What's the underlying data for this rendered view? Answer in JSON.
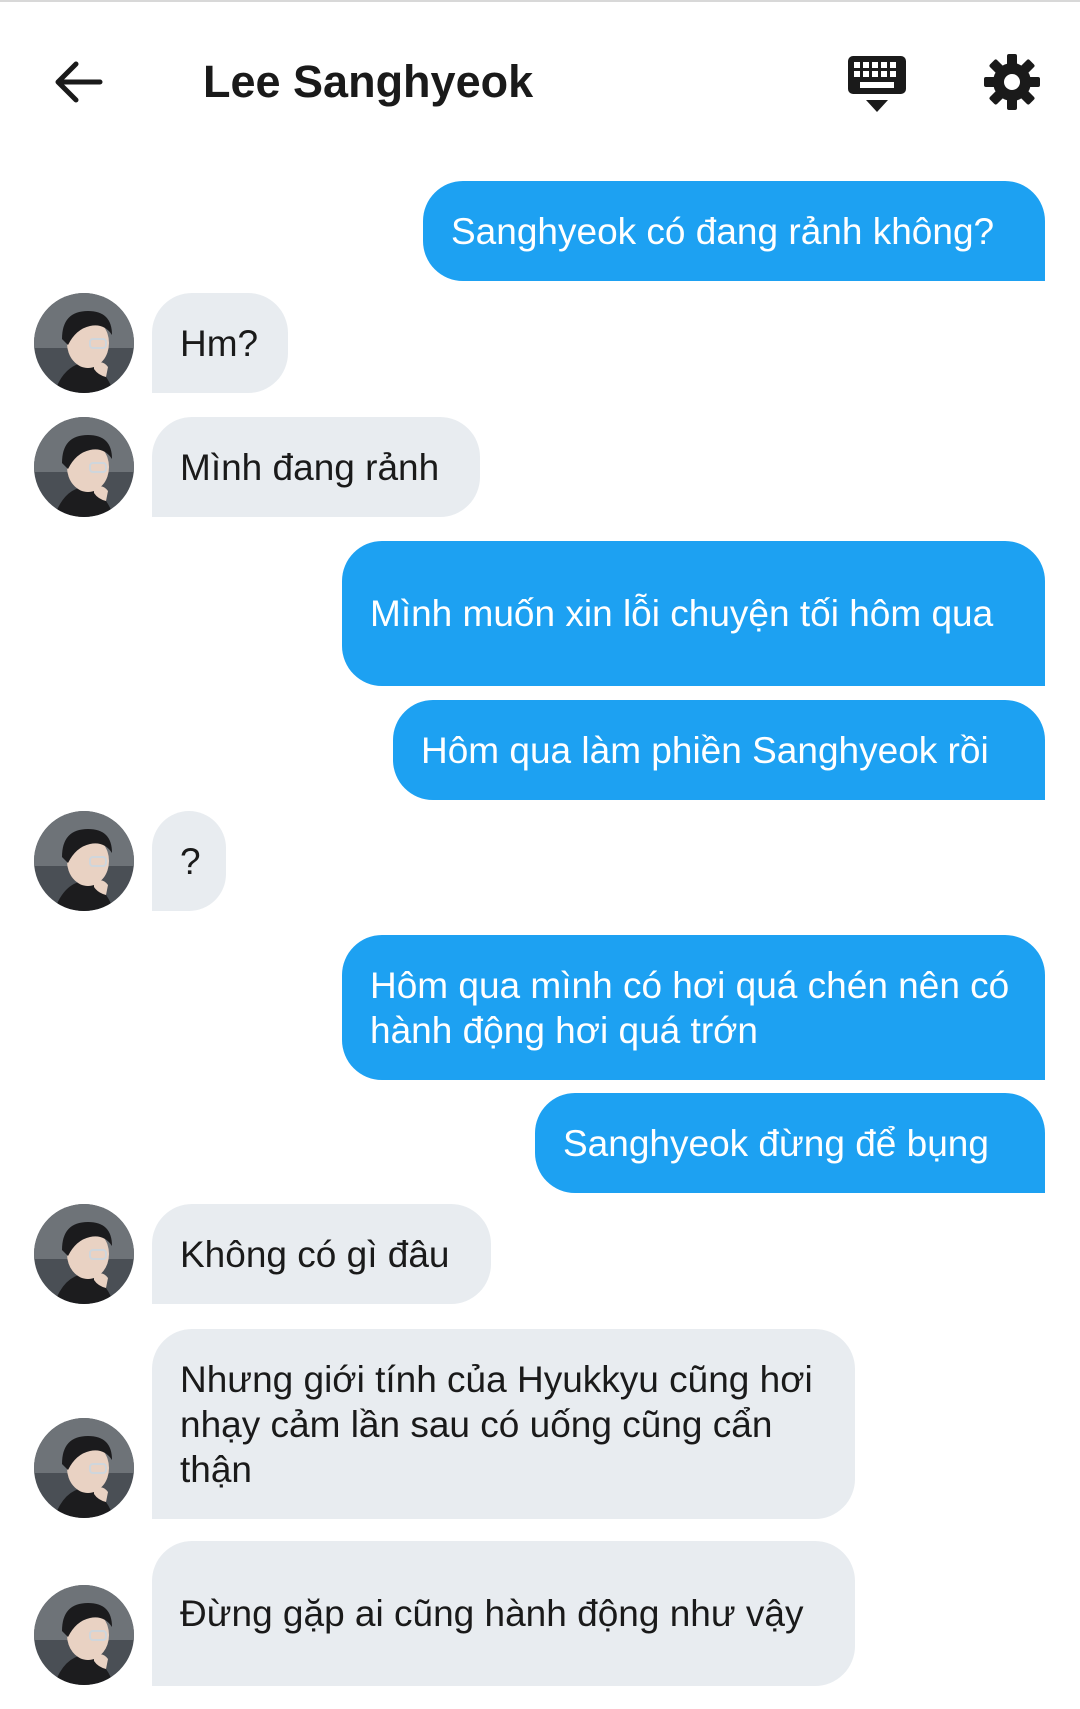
{
  "header": {
    "title": "Lee Sanghyeok",
    "back_icon": "arrow-left-icon",
    "keyboard_icon": "keyboard-hide-icon",
    "settings_icon": "gear-icon"
  },
  "colors": {
    "outgoing_bubble": "#1da1f2",
    "incoming_bubble": "#e8ecf0",
    "outgoing_text": "#ffffff",
    "incoming_text": "#1a1a1a"
  },
  "messages": [
    {
      "from": "me",
      "text": "Sanghyeok có đang rảnh không?"
    },
    {
      "from": "them",
      "text": "Hm?"
    },
    {
      "from": "them",
      "text": "Mình đang rảnh"
    },
    {
      "from": "me",
      "text": "Mình muốn xin lỗi chuyện tối hôm qua"
    },
    {
      "from": "me",
      "text": "Hôm qua làm phiền Sanghyeok rồi"
    },
    {
      "from": "them",
      "text": "?"
    },
    {
      "from": "me",
      "text": "Hôm qua mình có hơi quá chén nên có hành động hơi quá trớn"
    },
    {
      "from": "me",
      "text": "Sanghyeok đừng để bụng"
    },
    {
      "from": "them",
      "text": "Không có gì đâu"
    },
    {
      "from": "them",
      "text": "Nhưng giới tính của Hyukkyu cũng hơi nhạy cảm lần sau có uống cũng cẩn thận"
    },
    {
      "from": "them",
      "text": "Đừng gặp ai cũng hành động như vậy"
    }
  ]
}
